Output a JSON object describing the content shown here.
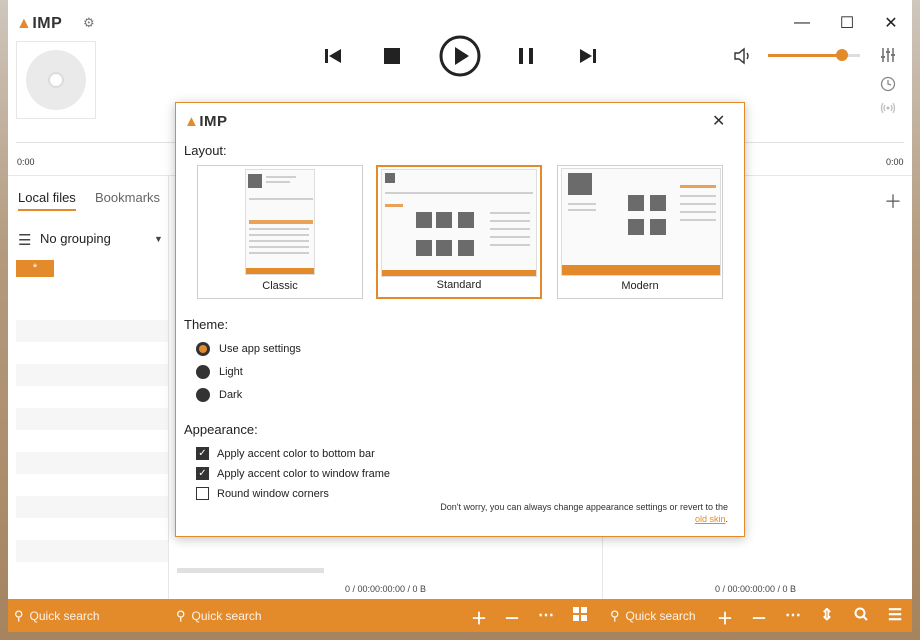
{
  "app": {
    "logo": "IMP",
    "settings_icon": "gear-icon",
    "accent_color": "#e38b2a"
  },
  "window_controls": {
    "minimize": "minimize-icon",
    "maximize": "maximize-icon",
    "close": "close-icon"
  },
  "player": {
    "time_left": "0:00",
    "time_right": "0:00",
    "volume_percent": 80,
    "controls": [
      "previous-icon",
      "stop-icon",
      "play-icon",
      "pause-icon",
      "next-icon"
    ]
  },
  "tabs": [
    {
      "label": "Local files",
      "active": true
    },
    {
      "label": "Bookmarks",
      "active": false
    }
  ],
  "grouping": {
    "label": "No grouping"
  },
  "star_chip": "*",
  "status": {
    "middle": "0 / 00:00:00:00 / 0 B",
    "right": "0 / 00:00:00:00 / 0 B"
  },
  "bottom_bar": {
    "search1_placeholder": "Quick search",
    "search2_placeholder": "Quick search",
    "search3_placeholder": "Quick search"
  },
  "dialog": {
    "logo": "IMP",
    "layout_heading": "Layout:",
    "layouts": [
      {
        "label": "Classic",
        "selected": false
      },
      {
        "label": "Standard",
        "selected": true
      },
      {
        "label": "Modern",
        "selected": false
      }
    ],
    "theme_heading": "Theme:",
    "themes": [
      {
        "label": "Use app settings",
        "selected": true
      },
      {
        "label": "Light",
        "selected": false
      },
      {
        "label": "Dark",
        "selected": false
      }
    ],
    "appearance_heading": "Appearance:",
    "appearance": [
      {
        "label": "Apply accent color to bottom bar",
        "checked": true
      },
      {
        "label": "Apply accent color to window frame",
        "checked": true
      },
      {
        "label": "Round window corners",
        "checked": false
      }
    ],
    "note_text": "Don't worry, you can always change appearance settings or revert to the",
    "note_link": "old skin",
    "note_end": "."
  }
}
